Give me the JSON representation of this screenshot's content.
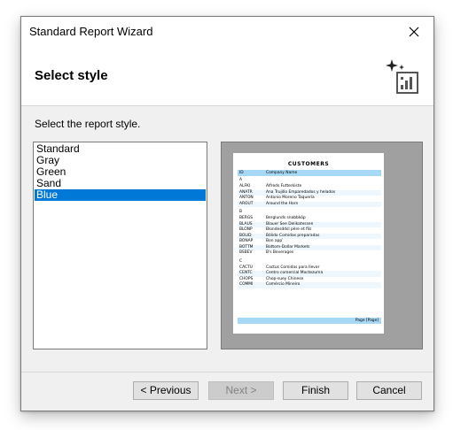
{
  "window": {
    "title": "Standard Report Wizard"
  },
  "header": {
    "title": "Select style"
  },
  "instruction": "Select the report style.",
  "styles": {
    "items": [
      "Standard",
      "Gray",
      "Green",
      "Sand",
      "Blue"
    ],
    "selected": "Blue"
  },
  "preview": {
    "report_title": "CUSTOMERS",
    "col_id": "ID",
    "col_name": "Company Name",
    "rows": [
      {
        "type": "group",
        "id": "A",
        "name": ""
      },
      {
        "type": "row",
        "id": "ALFKI",
        "name": "Alfreds Futterkiste"
      },
      {
        "type": "row",
        "id": "ANATR",
        "name": "Ana Trujillo Emparedados y helados"
      },
      {
        "type": "row",
        "id": "ANTON",
        "name": "Antonio Moreno Taquería"
      },
      {
        "type": "row",
        "id": "AROUT",
        "name": "Around the Horn"
      },
      {
        "type": "group",
        "id": "B",
        "name": ""
      },
      {
        "type": "row",
        "id": "BERGS",
        "name": "Berglunds snabbköp"
      },
      {
        "type": "row",
        "id": "BLAUS",
        "name": "Blauer See Delikatessen"
      },
      {
        "type": "row",
        "id": "BLONP",
        "name": "Blondesddsl père et fils"
      },
      {
        "type": "row",
        "id": "BOLID",
        "name": "Bólido Comidas preparadas"
      },
      {
        "type": "row",
        "id": "BONAP",
        "name": "Bon app'"
      },
      {
        "type": "row",
        "id": "BOTTM",
        "name": "Bottom-Dollar Markets"
      },
      {
        "type": "row",
        "id": "BSBEV",
        "name": "B's Beverages"
      },
      {
        "type": "group",
        "id": "C",
        "name": ""
      },
      {
        "type": "row",
        "id": "CACTU",
        "name": "Cactus Comidas para llevar"
      },
      {
        "type": "row",
        "id": "CENTC",
        "name": "Centro comercial Moctezuma"
      },
      {
        "type": "row",
        "id": "CHOPS",
        "name": "Chop-suey Chinese"
      },
      {
        "type": "row",
        "id": "COMMI",
        "name": "Comércio Mineiro"
      }
    ],
    "footer": "Page [Page]"
  },
  "buttons": {
    "previous": "< Previous",
    "next": "Next >",
    "finish": "Finish",
    "cancel": "Cancel"
  },
  "colors": {
    "selection": "#0078d7",
    "report_header": "#a7d8f6"
  }
}
